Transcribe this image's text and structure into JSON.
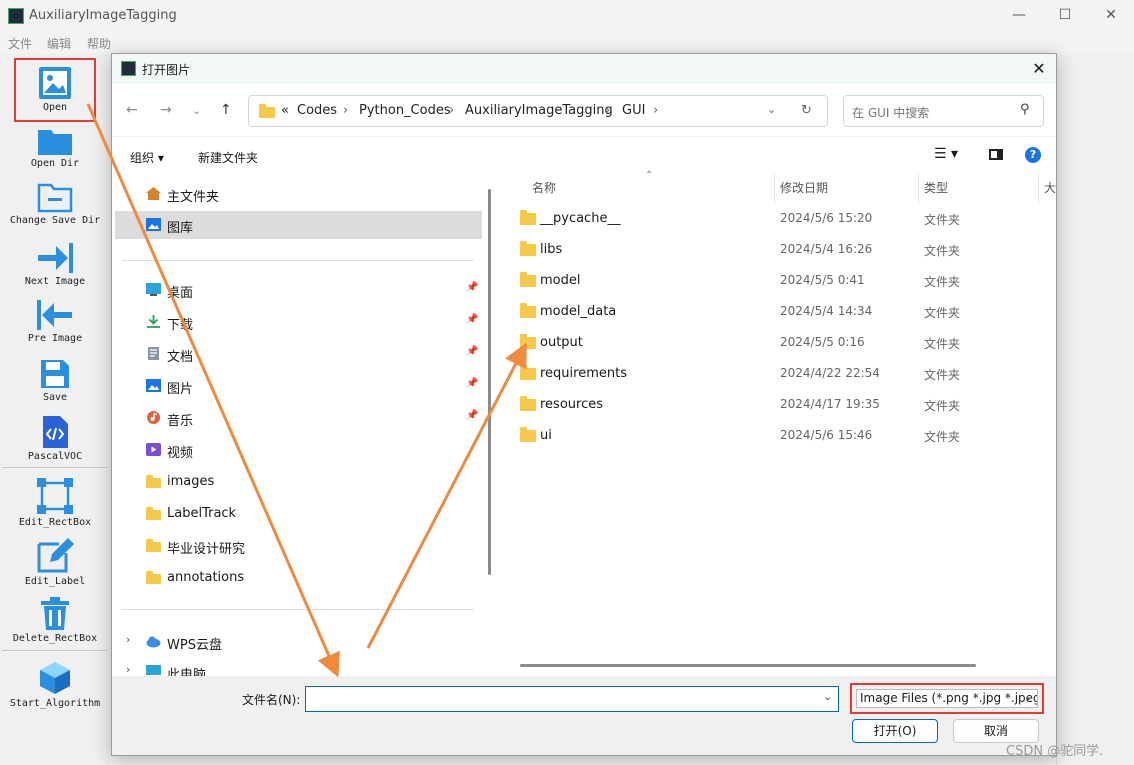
{
  "window": {
    "title": "AuxiliaryImageTagging",
    "minimize": "—",
    "maximize": "☐",
    "close": "✕"
  },
  "menu": [
    "文件",
    "编辑",
    "帮助"
  ],
  "toolbar": [
    {
      "label": "Open",
      "icon": "image-icon"
    },
    {
      "label": "Open Dir",
      "icon": "folder-icon"
    },
    {
      "label": "Change Save Dir",
      "icon": "folder-minus-icon"
    },
    {
      "label": "Next Image",
      "icon": "arrow-right-icon"
    },
    {
      "label": "Pre Image",
      "icon": "arrow-left-icon"
    },
    {
      "label": "Save",
      "icon": "floppy-icon"
    },
    {
      "label": "PascalVOC",
      "icon": "code-file-icon"
    },
    {
      "label": "Edit_RectBox",
      "icon": "rect-box-icon"
    },
    {
      "label": "Edit_Label",
      "icon": "pencil-icon"
    },
    {
      "label": "Delete_RectBox",
      "icon": "trash-icon"
    },
    {
      "label": "Start_Algorithm",
      "icon": "cube-icon"
    }
  ],
  "dialog": {
    "title": "打开图片",
    "close": "✕",
    "breadcrumb": [
      "«",
      "Codes",
      "Python_Codes",
      "AuxiliaryImageTagging",
      "GUI"
    ],
    "search_placeholder": "在 GUI 中搜索",
    "organize": "组织 ▾",
    "new_folder": "新建文件夹",
    "nav": {
      "top": [
        {
          "label": "主文件夹",
          "icon": "home-icon"
        },
        {
          "label": "图库",
          "icon": "gallery-icon"
        }
      ],
      "pinned": [
        {
          "label": "桌面",
          "icon": "desktop-icon"
        },
        {
          "label": "下载",
          "icon": "download-icon"
        },
        {
          "label": "文档",
          "icon": "document-icon"
        },
        {
          "label": "图片",
          "icon": "pictures-icon"
        },
        {
          "label": "音乐",
          "icon": "music-icon"
        },
        {
          "label": "视频",
          "icon": "video-icon"
        }
      ],
      "folders": [
        "images",
        "LabelTrack",
        "毕业设计研究",
        "annotations"
      ],
      "drives": [
        "WPS云盘",
        "此电脑"
      ]
    },
    "columns": {
      "name": "名称",
      "date": "修改日期",
      "type": "类型",
      "size": "大"
    },
    "files": [
      {
        "name": "__pycache__",
        "date": "2024/5/6 15:20",
        "type": "文件夹"
      },
      {
        "name": "libs",
        "date": "2024/5/4 16:26",
        "type": "文件夹"
      },
      {
        "name": "model",
        "date": "2024/5/5 0:41",
        "type": "文件夹"
      },
      {
        "name": "model_data",
        "date": "2024/5/4 14:34",
        "type": "文件夹"
      },
      {
        "name": "output",
        "date": "2024/5/5 0:16",
        "type": "文件夹"
      },
      {
        "name": "requirements",
        "date": "2024/4/22 22:54",
        "type": "文件夹"
      },
      {
        "name": "resources",
        "date": "2024/4/17 19:35",
        "type": "文件夹"
      },
      {
        "name": "ui",
        "date": "2024/5/6 15:46",
        "type": "文件夹"
      }
    ],
    "filename_label": "文件名(N):",
    "filename_value": "",
    "filetype": "Image Files (*.png *.jpg *.jpeg",
    "open_button": "打开(O)",
    "cancel_button": "取消"
  },
  "watermark": "CSDN @驼同学.",
  "colors": {
    "accent": "#0067c0",
    "highlight": "#e53935",
    "arrow": "#f08a3c",
    "folder": "#f7c948"
  }
}
